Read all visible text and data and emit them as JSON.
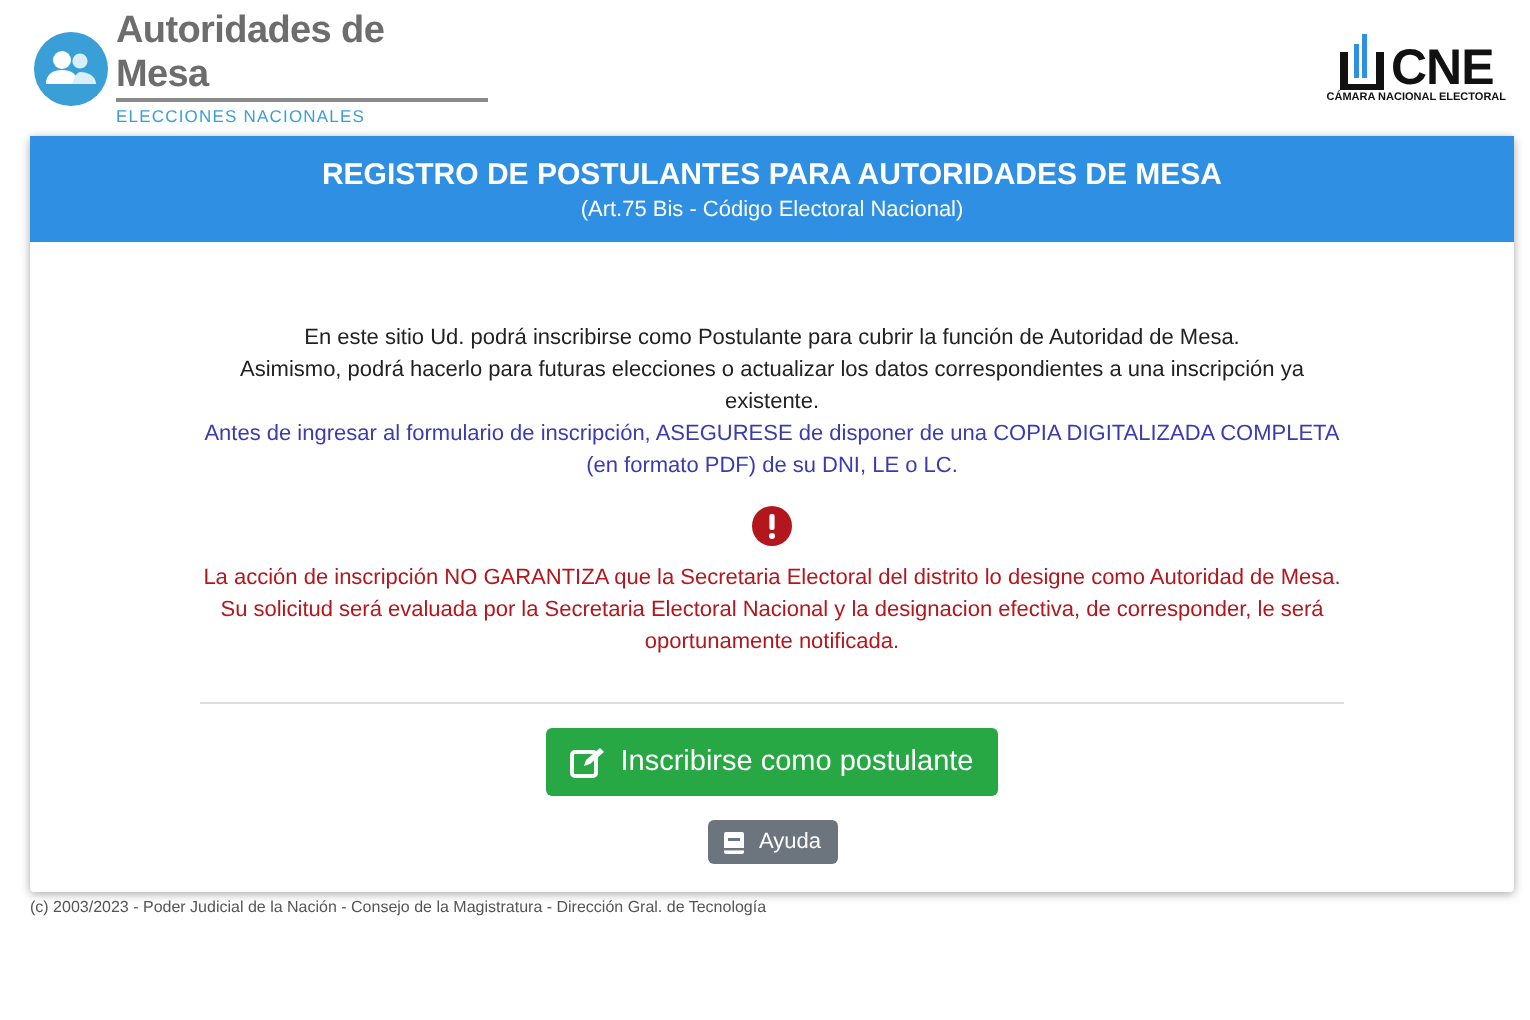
{
  "brand": {
    "title": "Autoridades de Mesa",
    "subtitle": "ELECCIONES NACIONALES"
  },
  "logo": {
    "mark": "CNE",
    "caption": "CÁMARA NACIONAL ELECTORAL"
  },
  "card": {
    "title": "REGISTRO DE POSTULANTES PARA AUTORIDADES DE MESA",
    "subtitle": "(Art.75 Bis - Código Electoral Nacional)",
    "paragraphs": [
      {
        "kind": "plain",
        "text": "En este sitio Ud. podrá inscribirse como Postulante para cubrir la función de Autoridad de Mesa."
      },
      {
        "kind": "plain",
        "text": "Asimismo, podrá hacerlo para futuras elecciones o actualizar los datos correspondientes a una inscripción ya existente."
      },
      {
        "kind": "info",
        "text": "Antes de ingresar al formulario de inscripción, ASEGURESE de disponer de una COPIA DIGITALIZADA COMPLETA (en formato PDF) de su DNI, LE o LC."
      },
      {
        "kind": "warning",
        "text": "La acción de inscripción NO GARANTIZA que la Secretaria Electoral del distrito lo designe como Autoridad de Mesa. Su solicitud será evaluada por la Secretaria Electoral Nacional y la designacion efectiva, de corresponder, le será oportunamente notificada."
      }
    ],
    "buttons": [
      {
        "kind": "primary",
        "label": "Inscribirse como postulante"
      },
      {
        "kind": "secondary",
        "label": "Ayuda"
      }
    ]
  },
  "footer": "(c) 2003/2023 - Poder Judicial de la Nación - Consejo de la Magistratura - Dirección Gral. de Tecnología"
}
